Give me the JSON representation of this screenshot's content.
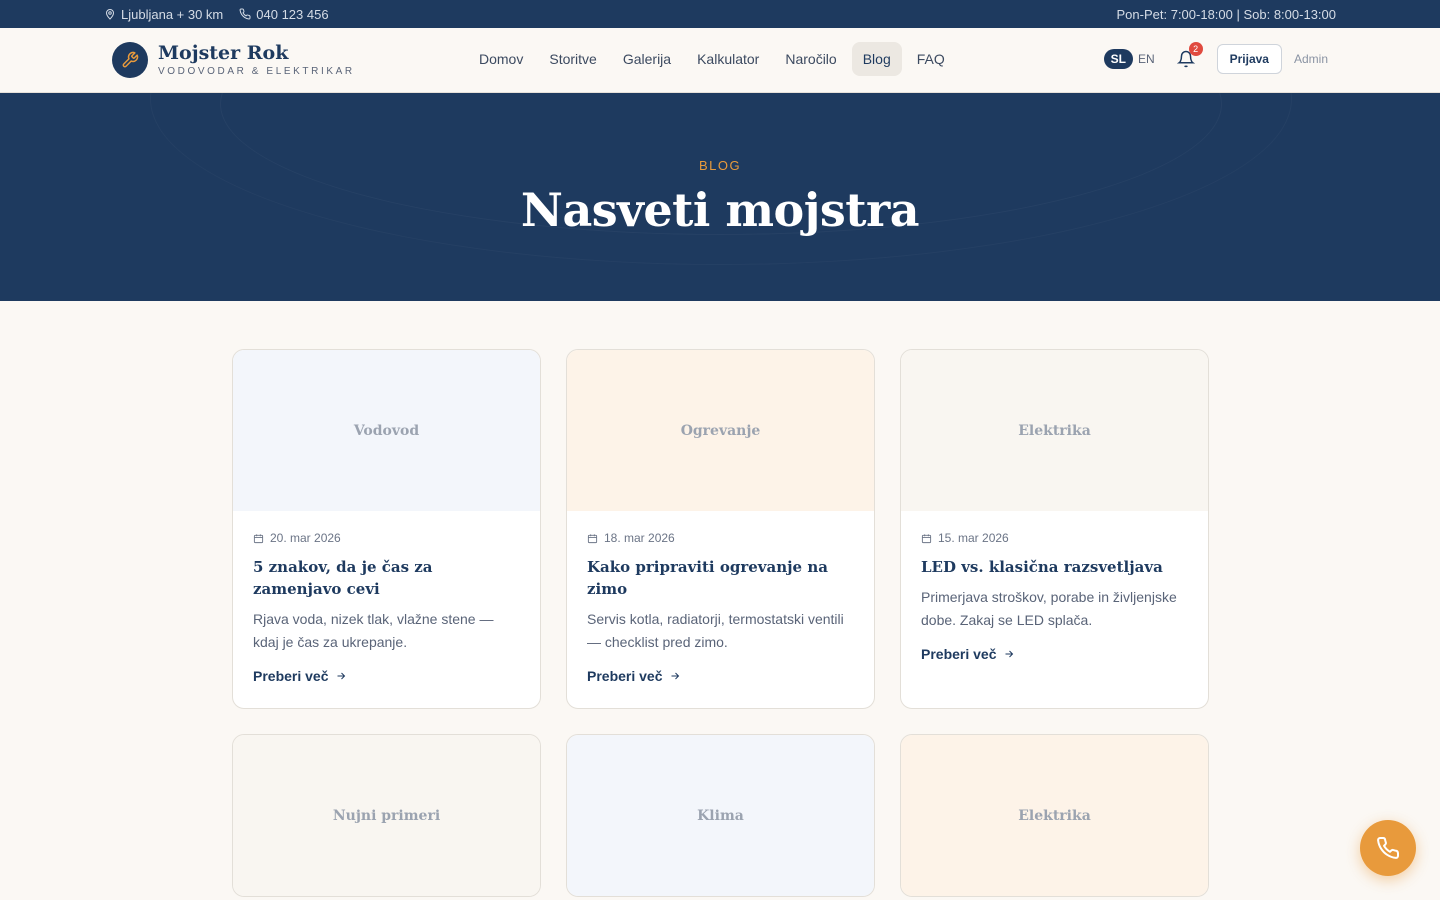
{
  "topbar": {
    "location": "Ljubljana + 30 km",
    "phone": "040 123 456",
    "hours": "Pon-Pet: 7:00-18:00 | Sob: 8:00-13:00"
  },
  "brand": {
    "name": "Mojster Rok",
    "subtitle": "VODOVODAR & ELEKTRIKAR"
  },
  "nav": {
    "items": [
      {
        "label": "Domov"
      },
      {
        "label": "Storitve"
      },
      {
        "label": "Galerija"
      },
      {
        "label": "Kalkulator"
      },
      {
        "label": "Naročilo"
      },
      {
        "label": "Blog",
        "active": true
      },
      {
        "label": "FAQ"
      }
    ]
  },
  "header": {
    "lang_active": "SL",
    "lang_other": "EN",
    "notifications_count": "2",
    "login_label": "Prijava",
    "admin_label": "Admin"
  },
  "hero": {
    "kicker": "BLOG",
    "title": "Nasveti mojstra"
  },
  "posts": [
    {
      "category": "Vodovod",
      "date": "20. mar 2026",
      "title": "5 znakov, da je čas za zamenjavo cevi",
      "excerpt": "Rjava voda, nizek tlak, vlažne stene — kdaj je čas za ukrepanje.",
      "link": "Preberi več"
    },
    {
      "category": "Ogrevanje",
      "date": "18. mar 2026",
      "title": "Kako pripraviti ogrevanje na zimo",
      "excerpt": "Servis kotla, radiatorji, termostatski ventili — checklist pred zimo.",
      "link": "Preberi več"
    },
    {
      "category": "Elektrika",
      "date": "15. mar 2026",
      "title": "LED vs. klasična razsvetljava",
      "excerpt": "Primerjava stroškov, porabe in življenjske dobe. Zakaj se LED splača.",
      "link": "Preberi več"
    },
    {
      "category": "Nujni primeri"
    },
    {
      "category": "Klima"
    },
    {
      "category": "Elektrika"
    }
  ],
  "colors": {
    "navy": "#1e3a5f",
    "accent": "#e89a3c",
    "badge": "#e04a3f"
  }
}
